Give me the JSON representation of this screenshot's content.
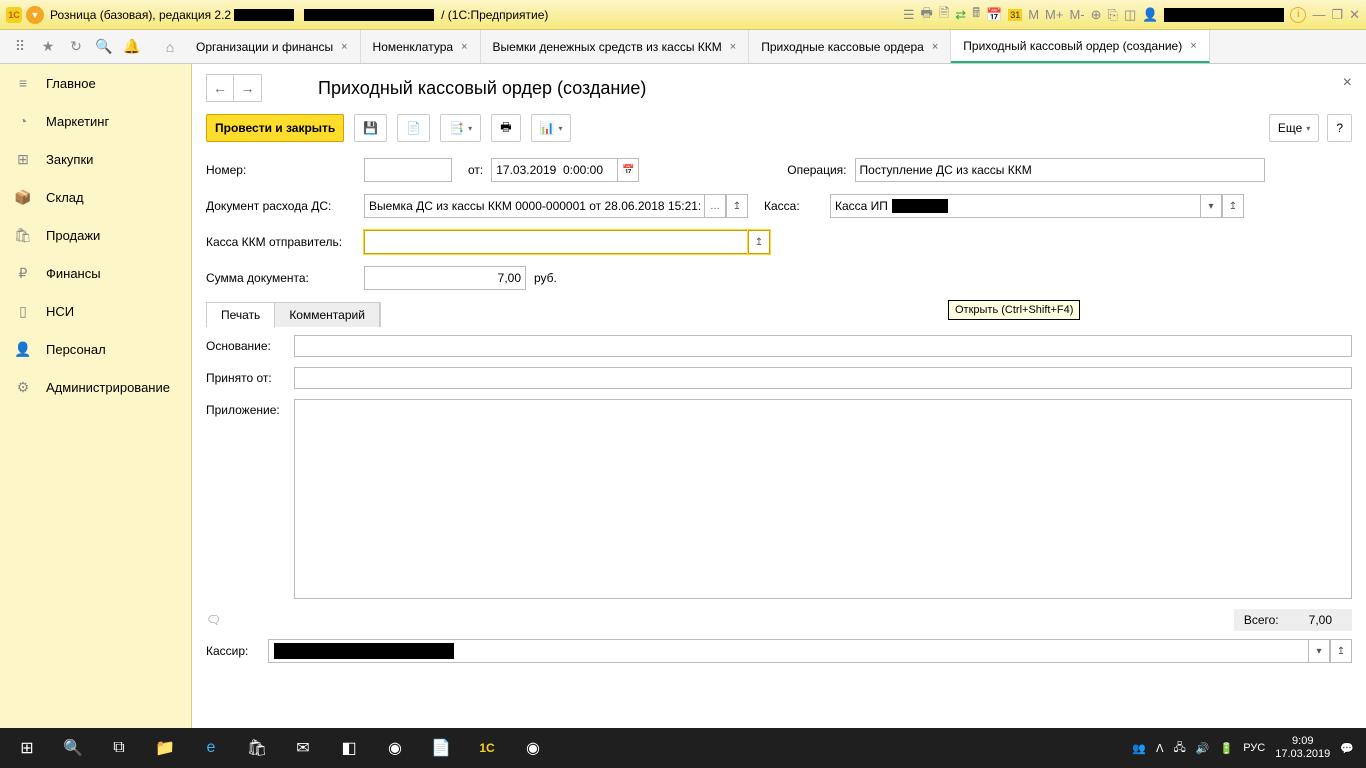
{
  "titlebar": {
    "app_prefix": "Розница (базовая), редакция 2.2",
    "app_suffix": "/ (1С:Предприятие)"
  },
  "tabs": {
    "t0": "Организации и финансы",
    "t1": "Номенклатура",
    "t2": "Выемки денежных средств из кассы ККМ",
    "t3": "Приходные кассовые ордера",
    "t4": "Приходный кассовый ордер (создание)"
  },
  "sidebar": {
    "s0": "Главное",
    "s1": "Маркетинг",
    "s2": "Закупки",
    "s3": "Склад",
    "s4": "Продажи",
    "s5": "Финансы",
    "s6": "НСИ",
    "s7": "Персонал",
    "s8": "Администрирование"
  },
  "page": {
    "title": "Приходный кассовый ордер (создание)"
  },
  "toolbar": {
    "post_close": "Провести и закрыть",
    "more": "Еще",
    "help": "?"
  },
  "form": {
    "number_lbl": "Номер:",
    "number_val": "",
    "from_lbl": "от:",
    "date_val": "17.03.2019  0:00:00",
    "operation_lbl": "Операция:",
    "operation_val": "Поступление ДС из кассы ККМ",
    "docexpense_lbl": "Документ расхода ДС:",
    "docexpense_val": "Выемка ДС из кассы ККМ 0000-000001 от 28.06.2018 15:21:",
    "kassa_lbl": "Касса:",
    "kassa_val": "Касса ИП",
    "kkm_lbl": "Касса ККМ отправитель:",
    "kkm_val": "",
    "sum_lbl": "Сумма документа:",
    "sum_val": "7,00",
    "currency": "руб."
  },
  "subtabs": {
    "print": "Печать",
    "comment": "Комментарий",
    "basis_lbl": "Основание:",
    "received_lbl": "Принято от:",
    "attach_lbl": "Приложение:"
  },
  "footer": {
    "total_lbl": "Всего:",
    "total_val": "7,00",
    "cashier_lbl": "Кассир:"
  },
  "tooltip": "Открыть (Ctrl+Shift+F4)",
  "taskbar": {
    "lang": "РУС",
    "time": "9:09",
    "date": "17.03.2019"
  }
}
